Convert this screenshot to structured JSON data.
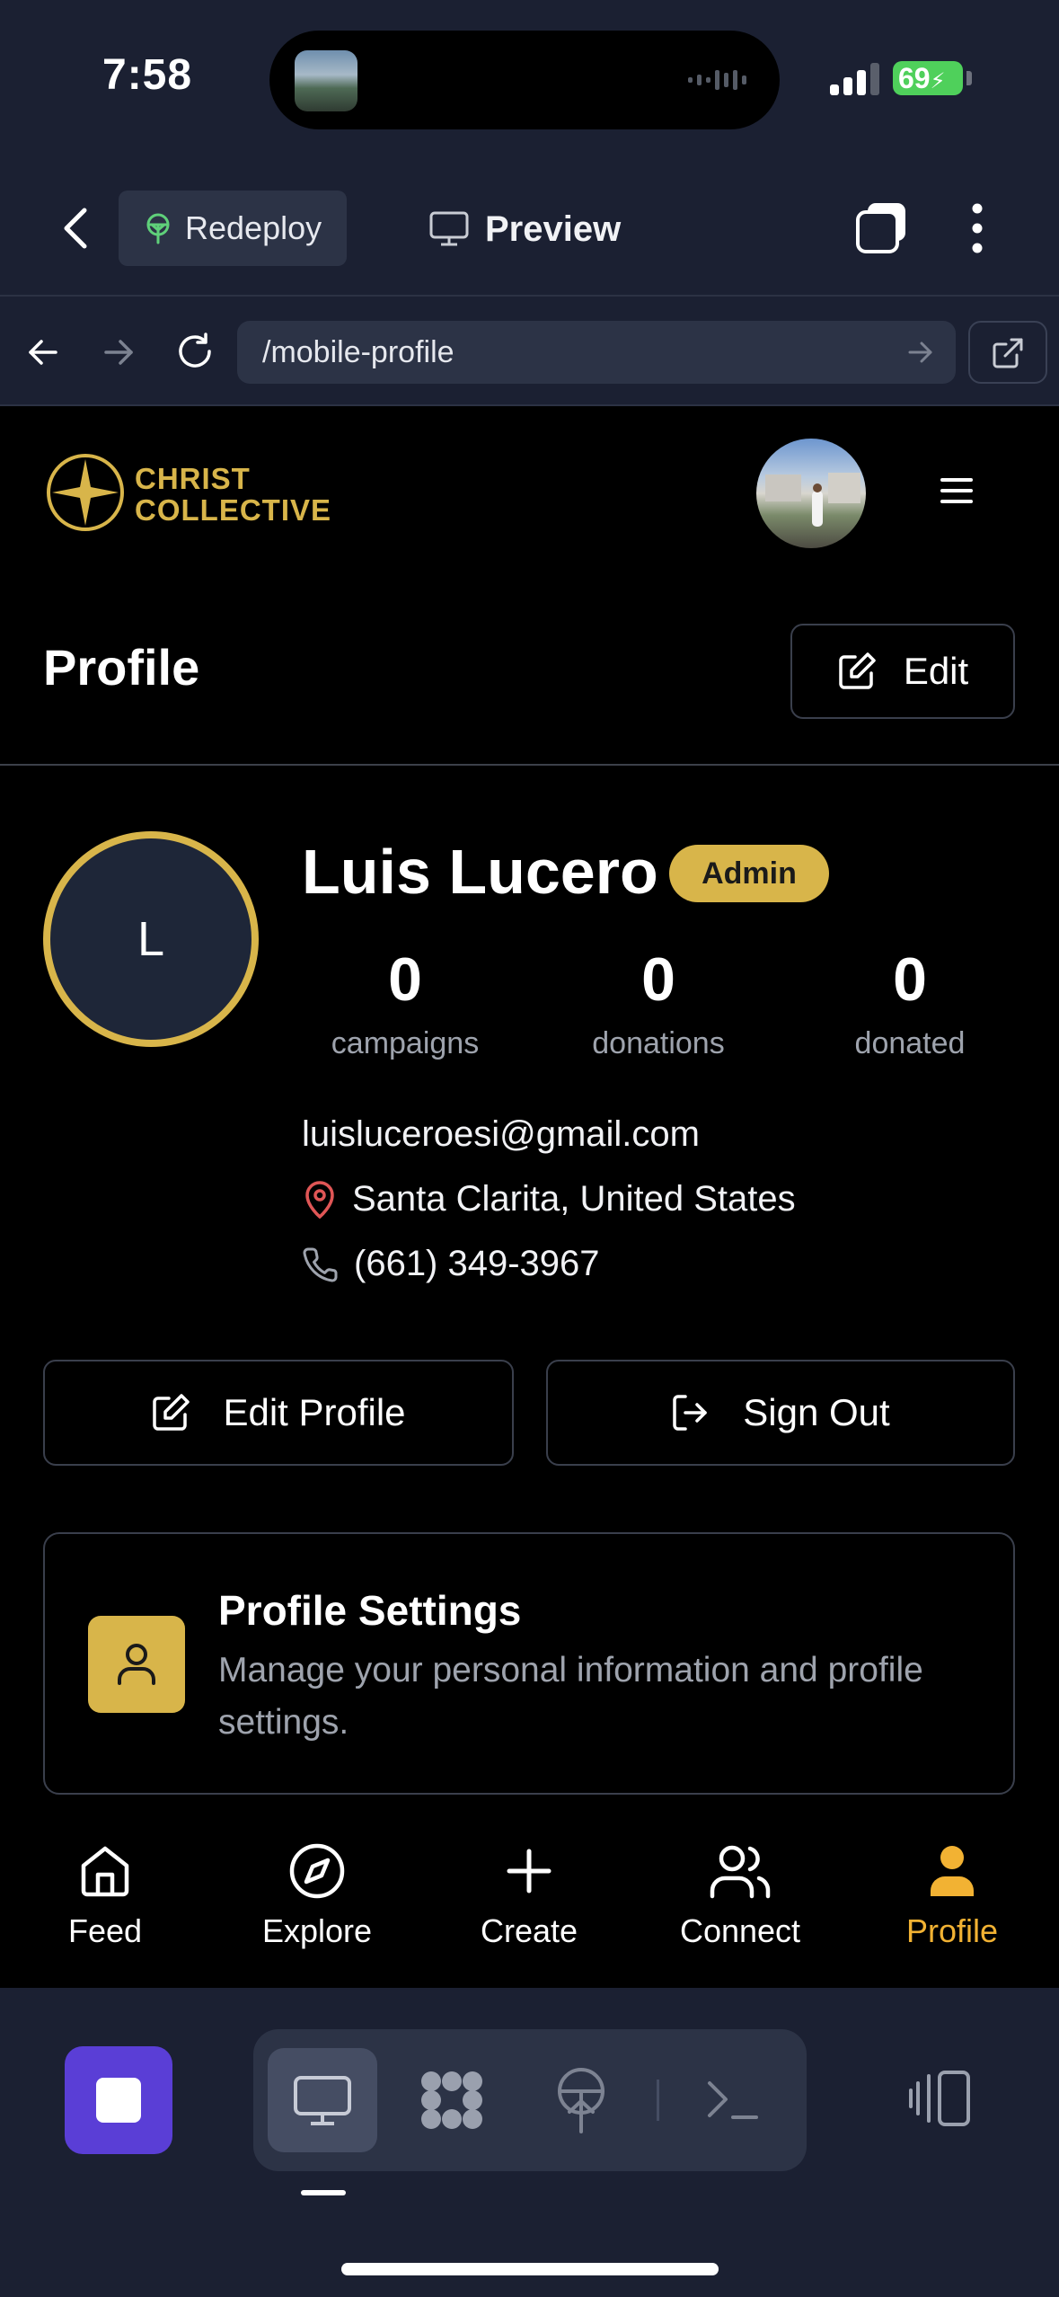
{
  "status_bar": {
    "time": "7:58",
    "battery": "69"
  },
  "app_bar": {
    "redeploy_label": "Redeploy",
    "preview_label": "Preview"
  },
  "url_bar": {
    "url": "/mobile-profile"
  },
  "site": {
    "logo_line1": "CHRIST",
    "logo_line2": "COLLECTIVE"
  },
  "page": {
    "title": "Profile",
    "edit_label": "Edit"
  },
  "profile": {
    "initial": "L",
    "name": "Luis Lucero",
    "role_badge": "Admin",
    "stats": [
      {
        "value": "0",
        "label": "campaigns"
      },
      {
        "value": "0",
        "label": "donations"
      },
      {
        "value": "0",
        "label": "donated"
      }
    ],
    "email": "luisluceroesi@gmail.com",
    "location": "Santa Clarita, United States",
    "phone": "(661) 349-3967"
  },
  "actions": {
    "edit_profile": "Edit Profile",
    "sign_out": "Sign Out"
  },
  "settings_card": {
    "title": "Profile Settings",
    "description": "Manage your personal information and profile settings."
  },
  "tabs": [
    {
      "label": "Feed",
      "icon": "home-icon"
    },
    {
      "label": "Explore",
      "icon": "compass-icon"
    },
    {
      "label": "Create",
      "icon": "plus-icon"
    },
    {
      "label": "Connect",
      "icon": "users-icon"
    },
    {
      "label": "Profile",
      "icon": "user-icon",
      "active": true
    }
  ],
  "colors": {
    "accent": "#d8b54a",
    "active_tab": "#f2b233",
    "stop_button": "#5a3ed6",
    "battery": "#4fd05b"
  }
}
